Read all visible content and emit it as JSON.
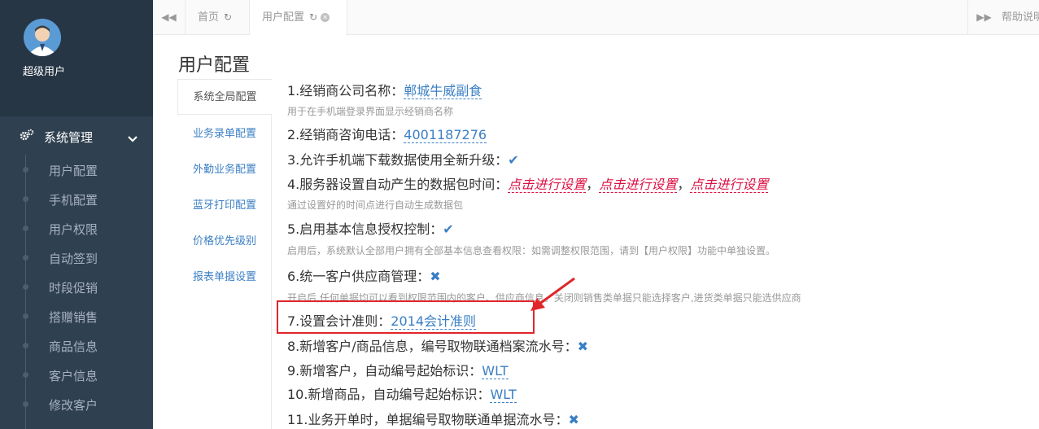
{
  "sidebar": {
    "user_name": "超级用户",
    "menu_head": {
      "label": "系统管理",
      "icon": "gears-icon",
      "expand_icon": "chevron-down-icon"
    },
    "items": [
      {
        "label": "用户配置"
      },
      {
        "label": "手机配置"
      },
      {
        "label": "用户权限"
      },
      {
        "label": "自动签到"
      },
      {
        "label": "时段促销"
      },
      {
        "label": "搭赠销售"
      },
      {
        "label": "商品信息"
      },
      {
        "label": "客户信息"
      },
      {
        "label": "修改客户"
      }
    ]
  },
  "tabbar": {
    "tabs": [
      {
        "label": "首页",
        "icon": "refresh-icon"
      },
      {
        "label": "用户配置",
        "icon": "refresh-icon",
        "close_icon": "close-icon"
      }
    ],
    "help_label": "帮助说明"
  },
  "page": {
    "title": "用户配置",
    "subnav": [
      "系统全局配置",
      "业务录单配置",
      "外勤业务配置",
      "蓝牙打印配置",
      "价格优先级别",
      "报表单据设置"
    ],
    "settings": {
      "s1_label": "1.经销商公司名称：",
      "s1_value": "郸城牛威副食",
      "s1_hint": "用于在手机端登录界面显示经销商名称",
      "s2_label": "2.经销商咨询电话：",
      "s2_value": "4001187276",
      "s3_label": "3.允许手机端下载数据使用全新升级：",
      "s3_mark": "✔",
      "s4_label": "4.服务器设置自动产生的数据包时间：",
      "s4_links": [
        "点击进行设置",
        "点击进行设置",
        "点击进行设置"
      ],
      "s4_sep": "，",
      "s4_hint": "通过设置好的时间点进行自动生成数据包",
      "s5_label": "5.启用基本信息授权控制：",
      "s5_mark": "✔",
      "s5_hint": "启用后，系统默认全部用户拥有全部基本信息查看权限：如需调整权限范围，请到【用户权限】功能中单独设置。",
      "s6_label": "6.统一客户供应商管理：",
      "s6_mark": "✖",
      "s6_hint": "开启后,任何单据均可以看到权限范围内的客户、供应商信息。关闭则销售类单据只能选择客户,进货类单据只能选供应商",
      "s7_label": "7.设置会计准则：",
      "s7_value": "2014会计准则",
      "s8_label": "8.新增客户/商品信息，编号取物联通档案流水号：",
      "s8_mark": "✖",
      "s9_label": "9.新增客户，自动编号起始标识：",
      "s9_value": "WLT",
      "s10_label": "10.新增商品，自动编号起始标识：",
      "s10_value": "WLT",
      "s11_label": "11.业务开单时，单据编号取物联通单据流水号：",
      "s11_mark": "✖"
    }
  },
  "colors": {
    "sidebar": "#2f4050",
    "accent": "#3b7fc4",
    "highlight": "#e0262a",
    "link_red": "#dd1144"
  }
}
